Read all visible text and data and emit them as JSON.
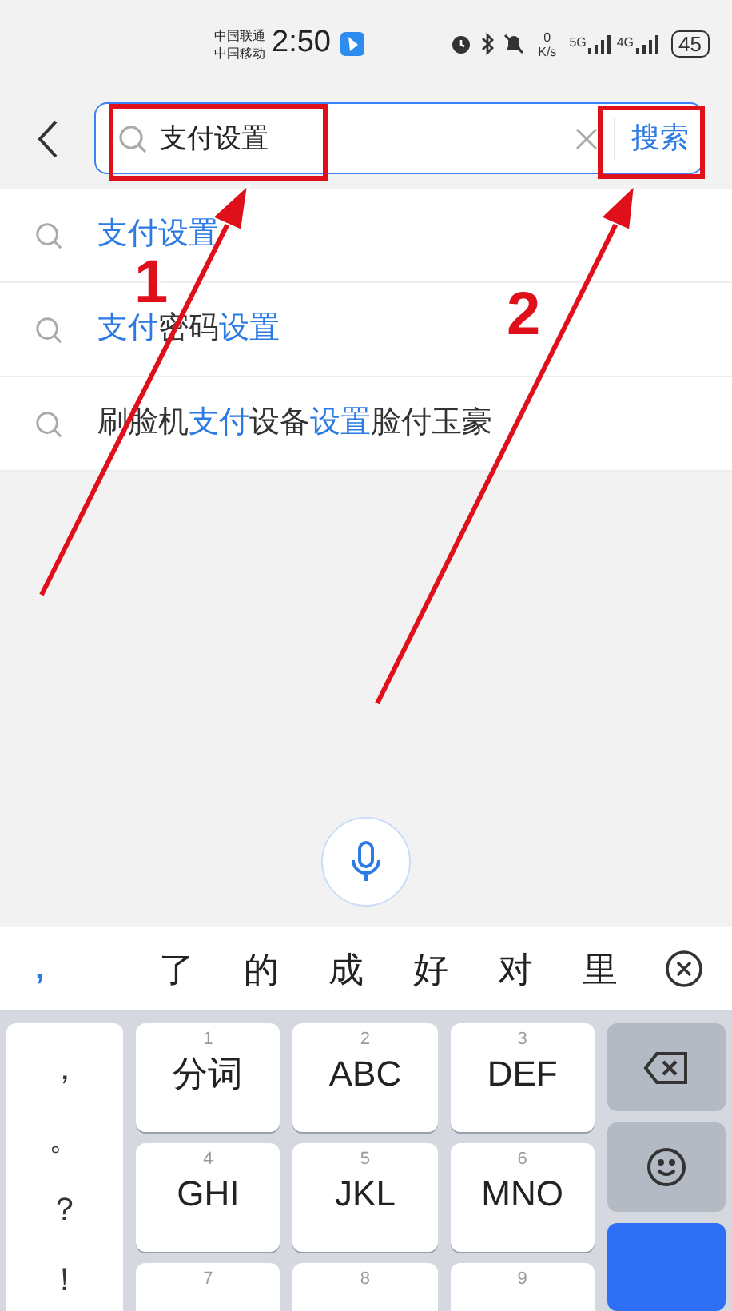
{
  "status_bar": {
    "carriers": [
      "中国联通",
      "中国移动"
    ],
    "time": "2:50",
    "speed_value": "0",
    "speed_unit": "K/s",
    "networks": [
      "5G",
      "4G"
    ],
    "battery": "45"
  },
  "search": {
    "value": "支付设置",
    "action": "搜索"
  },
  "suggestions": [
    {
      "segments": [
        {
          "text": "支付设置",
          "highlight": true
        }
      ]
    },
    {
      "segments": [
        {
          "text": "支付",
          "highlight": true
        },
        {
          "text": "密码",
          "highlight": false
        },
        {
          "text": "设置",
          "highlight": true
        }
      ]
    },
    {
      "segments": [
        {
          "text": "刷脸机",
          "highlight": false
        },
        {
          "text": "支付",
          "highlight": true
        },
        {
          "text": "设备",
          "highlight": false
        },
        {
          "text": "设置",
          "highlight": true
        },
        {
          "text": "脸付玉豪",
          "highlight": false
        }
      ]
    }
  ],
  "candidates": {
    "lead": ",",
    "words": [
      "了",
      "的",
      "成",
      "好",
      "对",
      "里"
    ]
  },
  "keyboard": {
    "symbols": [
      "，",
      "。",
      "？",
      "！"
    ],
    "rows": [
      [
        {
          "digit": "1",
          "label": "分词"
        },
        {
          "digit": "2",
          "label": "ABC"
        },
        {
          "digit": "3",
          "label": "DEF"
        }
      ],
      [
        {
          "digit": "4",
          "label": "GHI"
        },
        {
          "digit": "5",
          "label": "JKL"
        },
        {
          "digit": "6",
          "label": "MNO"
        }
      ],
      [
        {
          "digit": "7"
        },
        {
          "digit": "8"
        },
        {
          "digit": "9"
        }
      ]
    ],
    "side": [
      {
        "kind": "backspace"
      },
      {
        "kind": "emoji"
      },
      {
        "kind": "enter"
      }
    ]
  },
  "annotations": [
    {
      "label": "1"
    },
    {
      "label": "2"
    }
  ]
}
